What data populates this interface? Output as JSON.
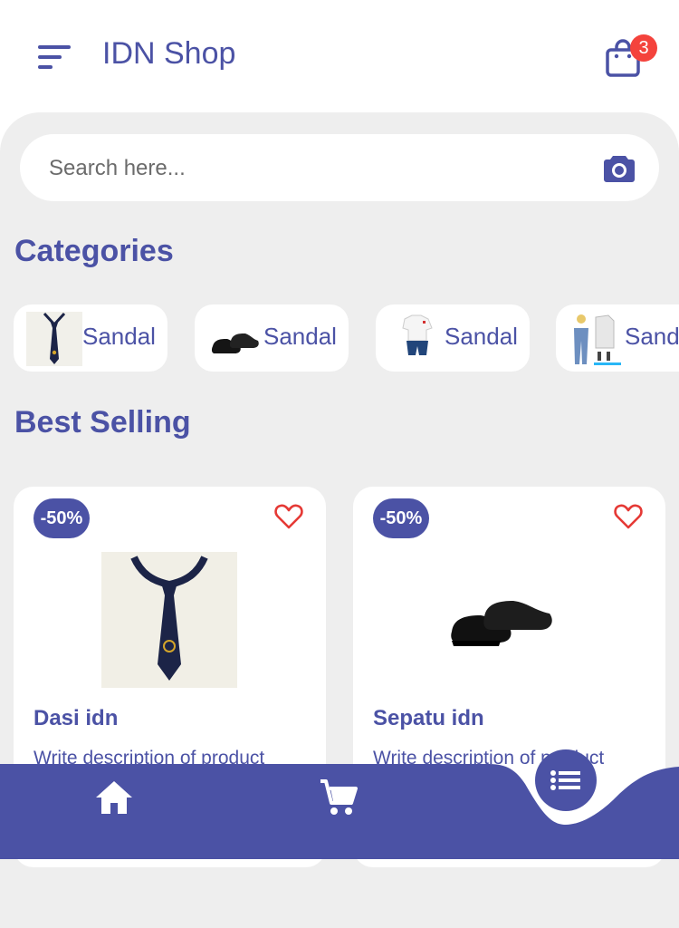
{
  "appbar": {
    "title": "IDN Shop",
    "menu_icon": "menu-icon",
    "cart_icon": "shopping-bag-icon",
    "cart_count": "3"
  },
  "search": {
    "placeholder": "Search here...",
    "camera_icon": "camera-icon"
  },
  "categories": {
    "title": "Categories",
    "items": [
      {
        "label": "Sandal",
        "image": "tie-image"
      },
      {
        "label": "Sandal",
        "image": "black-shoes-image"
      },
      {
        "label": "Sandal",
        "image": "uniform-image"
      },
      {
        "label": "Sandal",
        "image": "clothing-set-image"
      }
    ]
  },
  "best_selling": {
    "title": "Best Selling",
    "products": [
      {
        "discount": "-50%",
        "name": "Dasi idn",
        "description": "Write description of product",
        "image": "tie-image",
        "favorite_icon": "heart-icon"
      },
      {
        "discount": "-50%",
        "name": "Sepatu idn",
        "description": "Write description of product",
        "image": "black-shoes-image",
        "favorite_icon": "heart-icon"
      }
    ]
  },
  "bottom_nav": {
    "items": [
      "home-icon",
      "cart-icon",
      "list-icon"
    ]
  },
  "colors": {
    "primary": "#4b52a5",
    "badge": "#f4433c",
    "heart": "#e53935",
    "background": "#eeeeee"
  }
}
